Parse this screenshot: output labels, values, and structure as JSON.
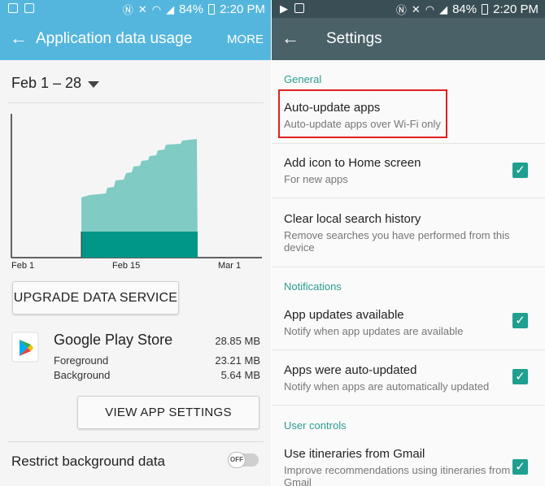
{
  "left": {
    "status": {
      "battery": "84%",
      "time": "2:20 PM"
    },
    "appbar": {
      "title": "Application data usage",
      "more": "MORE"
    },
    "date_range": "Feb 1 – 28",
    "chart_data": {
      "type": "area",
      "x_labels": [
        "Feb 1",
        "Feb 15",
        "Mar 1"
      ],
      "series": [
        {
          "role": "total",
          "color": "#80cbc4"
        },
        {
          "role": "foreground",
          "color": "#009688"
        }
      ]
    },
    "upgrade_button": "UPGRADE DATA SERVICE",
    "app": {
      "name": "Google Play Store",
      "total": "28.85 MB",
      "foreground_label": "Foreground",
      "foreground_value": "23.21 MB",
      "background_label": "Background",
      "background_value": "5.64 MB"
    },
    "view_settings_button": "VIEW APP SETTINGS",
    "restrict_label": "Restrict background data",
    "toggle_state": "OFF"
  },
  "right": {
    "status": {
      "battery": "84%",
      "time": "2:20 PM"
    },
    "appbar": {
      "title": "Settings"
    },
    "general": {
      "header": "General",
      "auto_update": {
        "title": "Auto-update apps",
        "subtitle": "Auto-update apps over Wi-Fi only"
      },
      "add_icon": {
        "title": "Add icon to Home screen",
        "subtitle": "For new apps"
      },
      "clear_history": {
        "title": "Clear local search history",
        "subtitle": "Remove searches you have performed from this device"
      }
    },
    "notifications": {
      "header": "Notifications",
      "app_updates": {
        "title": "App updates available",
        "subtitle": "Notify when app updates are available"
      },
      "auto_updated": {
        "title": "Apps were auto-updated",
        "subtitle": "Notify when apps are automatically updated"
      }
    },
    "user_controls": {
      "header": "User controls",
      "itineraries": {
        "title": "Use itineraries from Gmail",
        "subtitle": "Improve recommendations using itineraries from Gmail"
      }
    },
    "accent_color": "#1f9f8f"
  }
}
